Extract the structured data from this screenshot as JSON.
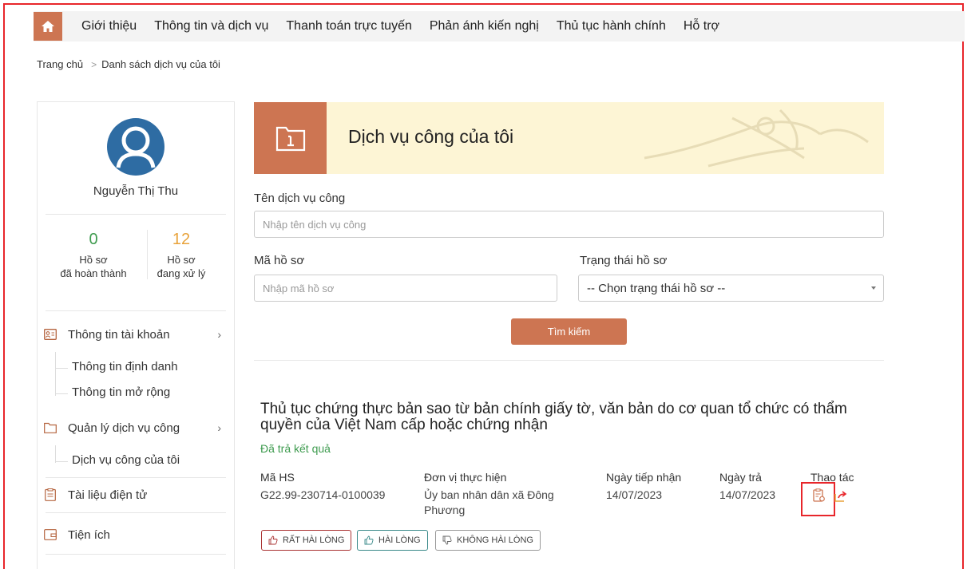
{
  "colors": {
    "accent": "#cd7552",
    "highlight": "#e8262b",
    "banner_bg": "#fdf5d5",
    "done_stat": "#3e9b4f",
    "processing_stat": "#e8a23a"
  },
  "nav": {
    "home_icon": "home-icon",
    "items": [
      "Giới thiệu",
      "Thông tin và dịch vụ",
      "Thanh toán trực tuyến",
      "Phản ánh kiến nghị",
      "Thủ tục hành chính",
      "Hỗ trợ"
    ]
  },
  "breadcrumb": {
    "home": "Trang chủ",
    "separator": ">",
    "current": "Danh sách dịch vụ của tôi"
  },
  "sidebar": {
    "user_name": "Nguyễn Thị Thu",
    "stats": {
      "done": {
        "value": "0",
        "label_1": "Hồ sơ",
        "label_2": "đã hoàn thành"
      },
      "processing": {
        "value": "12",
        "label_1": "Hồ sơ",
        "label_2": "đang xử lý"
      }
    },
    "menu": {
      "account": "Thông tin tài khoản",
      "account_sub": [
        "Thông tin định danh",
        "Thông tin mở rộng"
      ],
      "services": "Quản lý dịch vụ công",
      "services_sub": [
        "Dịch vụ công của tôi"
      ],
      "documents": "Tài liệu điện tử",
      "utilities": "Tiện ích"
    }
  },
  "banner": {
    "title": "Dịch vụ công của tôi"
  },
  "search": {
    "name_label": "Tên dịch vụ công",
    "name_placeholder": "Nhập tên dịch vụ công",
    "code_label": "Mã hồ sơ",
    "code_placeholder": "Nhập mã hồ sơ",
    "status_label": "Trạng thái hồ sơ",
    "status_selected": "-- Chọn trạng thái hồ sơ --",
    "button": "Tìm kiếm"
  },
  "record": {
    "title": "Thủ tục chứng thực bản sao từ bản chính giấy tờ, văn bản do cơ quan tổ chức có thẩm quyền của Việt Nam cấp hoặc chứng nhận",
    "status": "Đã trả kết quả",
    "headers": {
      "code": "Mã HS",
      "unit": "Đơn vị thực hiện",
      "received": "Ngày tiếp nhận",
      "returned": "Ngày trả",
      "actions": "Thao tác"
    },
    "values": {
      "code": "G22.99-230714-0100039",
      "unit": "Ủy ban nhân dân xã Đông Phương",
      "received": "14/07/2023",
      "returned": "14/07/2023"
    },
    "ratings": [
      "RẤT HÀI LÒNG",
      "HÀI LÒNG",
      "KHÔNG HÀI LÒNG"
    ]
  }
}
